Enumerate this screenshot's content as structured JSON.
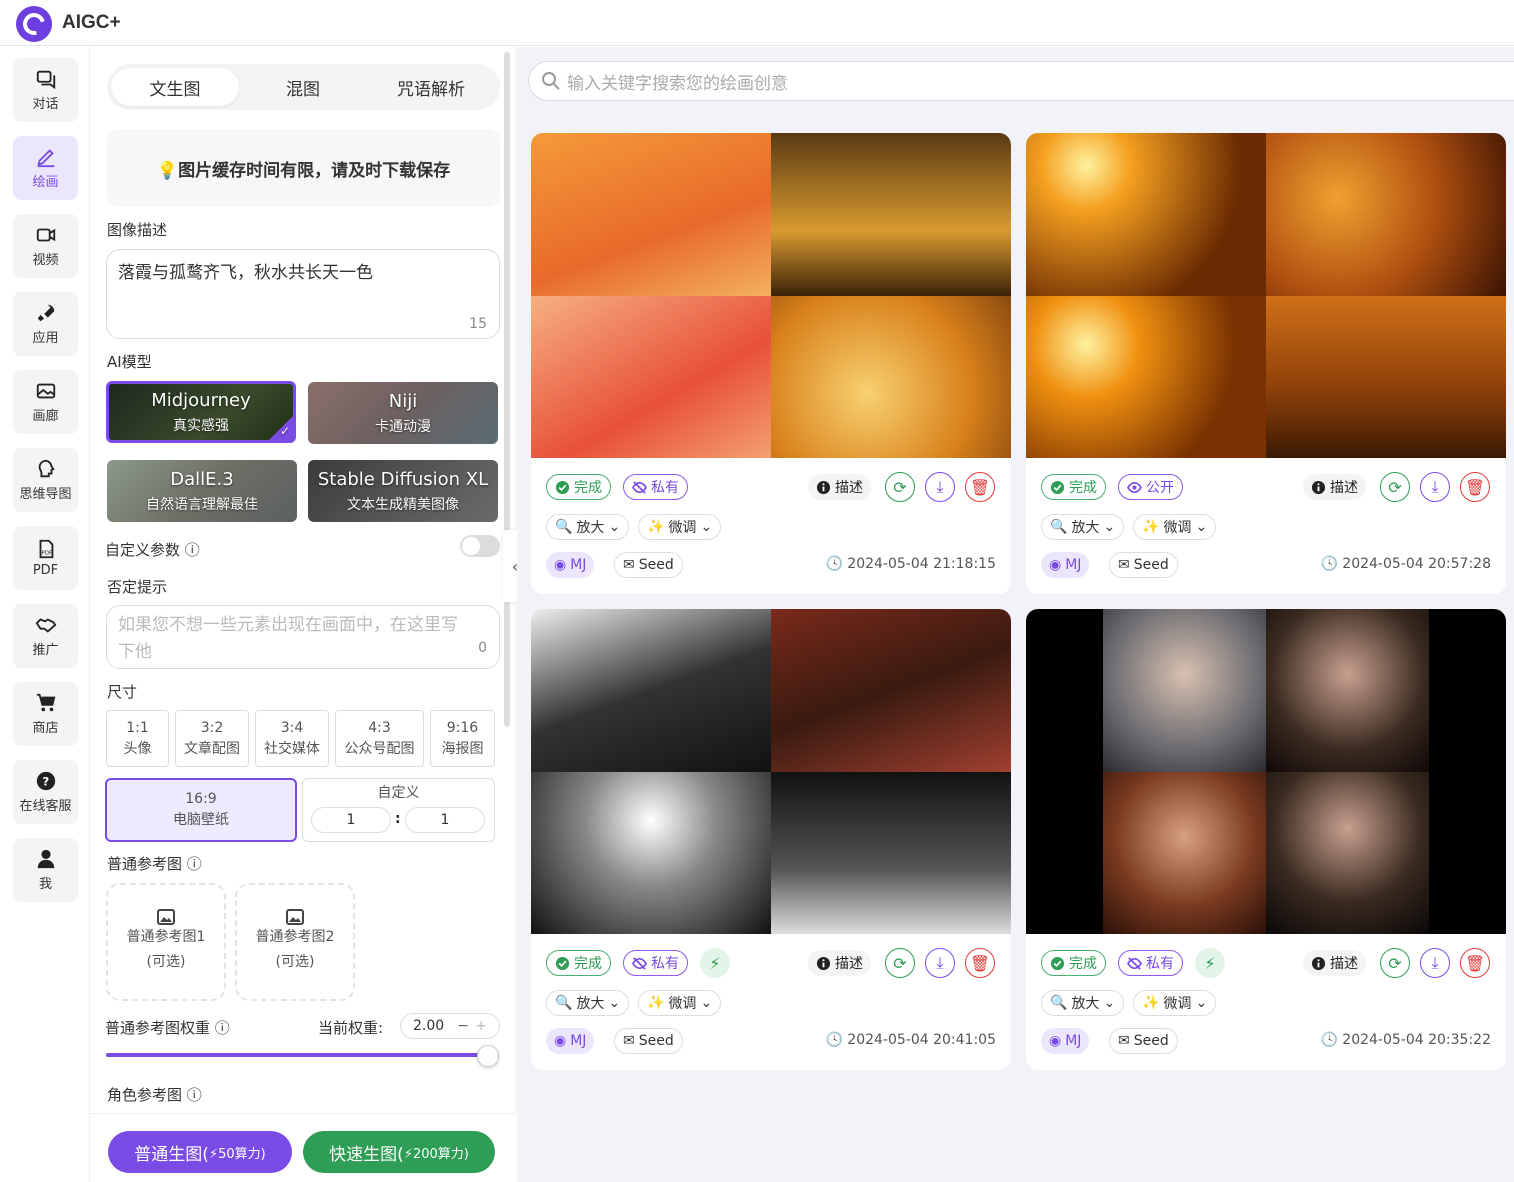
{
  "app": {
    "title": "AIGC+"
  },
  "nav": [
    {
      "label": "对话",
      "icon": "chat-icon"
    },
    {
      "label": "绘画",
      "icon": "paint-icon",
      "active": true
    },
    {
      "label": "视频",
      "icon": "video-icon"
    },
    {
      "label": "应用",
      "icon": "rocket-icon"
    },
    {
      "label": "画廊",
      "icon": "gallery-icon"
    },
    {
      "label": "思维导图",
      "icon": "mindmap-icon"
    },
    {
      "label": "PDF",
      "icon": "pdf-icon"
    },
    {
      "label": "推广",
      "icon": "handshake-icon"
    },
    {
      "label": "商店",
      "icon": "cart-icon"
    },
    {
      "label": "在线客服",
      "icon": "help-icon"
    },
    {
      "label": "我",
      "icon": "user-icon"
    }
  ],
  "panel": {
    "tabs": [
      "文生图",
      "混图",
      "咒语解析"
    ],
    "notice": "💡图片缓存时间有限，请及时下载保存",
    "desc_label": "图像描述",
    "desc_value": "落霞与孤鹜齐飞，秋水共长天一色",
    "desc_count": "15",
    "model_label": "AI模型",
    "models": [
      {
        "name": "Midjourney",
        "sub": "真实感强"
      },
      {
        "name": "Niji",
        "sub": "卡通动漫"
      },
      {
        "name": "DallE.3",
        "sub": "自然语言理解最佳"
      },
      {
        "name": "Stable Diffusion XL",
        "sub": "文本生成精美图像"
      }
    ],
    "custom_params_label": "自定义参数",
    "negative_label": "否定提示",
    "negative_placeholder": "如果您不想一些元素出现在画面中，在这里写下他",
    "negative_count": "0",
    "size_label": "尺寸",
    "sizes": [
      {
        "ratio": "1:1",
        "name": "头像"
      },
      {
        "ratio": "3:2",
        "name": "文章配图"
      },
      {
        "ratio": "3:4",
        "name": "社交媒体"
      },
      {
        "ratio": "4:3",
        "name": "公众号配图"
      },
      {
        "ratio": "9:16",
        "name": "海报图"
      },
      {
        "ratio": "16:9",
        "name": "电脑壁纸"
      }
    ],
    "custom_size": {
      "label": "自定义",
      "w": "1",
      "sep": ":",
      "h": "1"
    },
    "ref_label": "普通参考图",
    "refs": [
      {
        "name": "普通参考图1",
        "note": "(可选)"
      },
      {
        "name": "普通参考图2",
        "note": "(可选)"
      }
    ],
    "weight_label": "普通参考图权重",
    "current_weight_label": "当前权重:",
    "weight_value": "2.00",
    "weight_fraction": 1.0,
    "char_ref_label": "角色参考图",
    "btn_normal": "普通生图(",
    "btn_normal_cost": "⚡50算力)",
    "btn_fast": "快速生图(",
    "btn_fast_cost": "⚡200算力)"
  },
  "search": {
    "placeholder": "输入关键字搜索您的绘画创意"
  },
  "cards": [
    {
      "status": "完成",
      "visibility": "私有",
      "describe": "描述",
      "upscale": "放大",
      "tweak": "微调",
      "model": "MJ",
      "seed": "Seed",
      "time": "2024-05-04 21:18:15",
      "fast": false
    },
    {
      "status": "完成",
      "visibility": "公开",
      "describe": "描述",
      "upscale": "放大",
      "tweak": "微调",
      "model": "MJ",
      "seed": "Seed",
      "time": "2024-05-04 20:57:28",
      "fast": false
    },
    {
      "status": "完成",
      "visibility": "私有",
      "describe": "描述",
      "upscale": "放大",
      "tweak": "微调",
      "model": "MJ",
      "seed": "Seed",
      "time": "2024-05-04 20:41:05",
      "fast": true
    },
    {
      "status": "完成",
      "visibility": "私有",
      "describe": "描述",
      "upscale": "放大",
      "tweak": "微调",
      "model": "MJ",
      "seed": "Seed",
      "time": "2024-05-04 20:35:22",
      "fast": true
    }
  ],
  "colors": {
    "accent": "#7a4be5",
    "green": "#2e9d55",
    "red": "#e03a3a"
  }
}
